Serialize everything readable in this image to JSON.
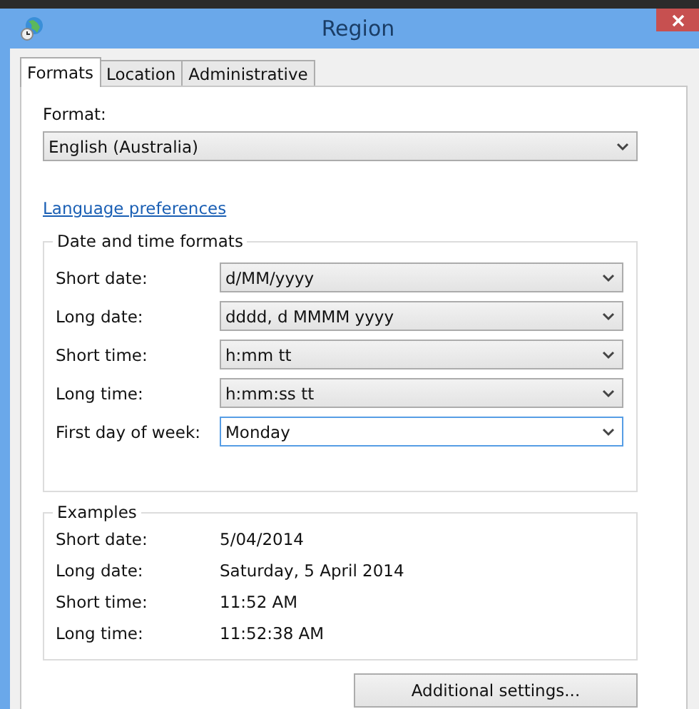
{
  "window": {
    "title": "Region"
  },
  "tabs": [
    {
      "label": "Formats",
      "selected": true
    },
    {
      "label": "Location",
      "selected": false
    },
    {
      "label": "Administrative",
      "selected": false
    }
  ],
  "format": {
    "label": "Format:",
    "value": "English (Australia)"
  },
  "language_link": "Language preferences",
  "date_time_formats": {
    "title": "Date and time formats",
    "rows": [
      {
        "label": "Short date:",
        "value": "d/MM/yyyy",
        "focused": false
      },
      {
        "label": "Long date:",
        "value": "dddd, d MMMM yyyy",
        "focused": false
      },
      {
        "label": "Short time:",
        "value": "h:mm tt",
        "focused": false
      },
      {
        "label": "Long time:",
        "value": "h:mm:ss tt",
        "focused": false
      },
      {
        "label": "First day of week:",
        "value": "Monday",
        "focused": true
      }
    ]
  },
  "examples": {
    "title": "Examples",
    "rows": [
      {
        "label": "Short date:",
        "value": "5/04/2014"
      },
      {
        "label": "Long date:",
        "value": "Saturday, 5 April 2014"
      },
      {
        "label": "Short time:",
        "value": "11:52 AM"
      },
      {
        "label": "Long time:",
        "value": "11:52:38 AM"
      }
    ]
  },
  "additional_button": "Additional settings..."
}
